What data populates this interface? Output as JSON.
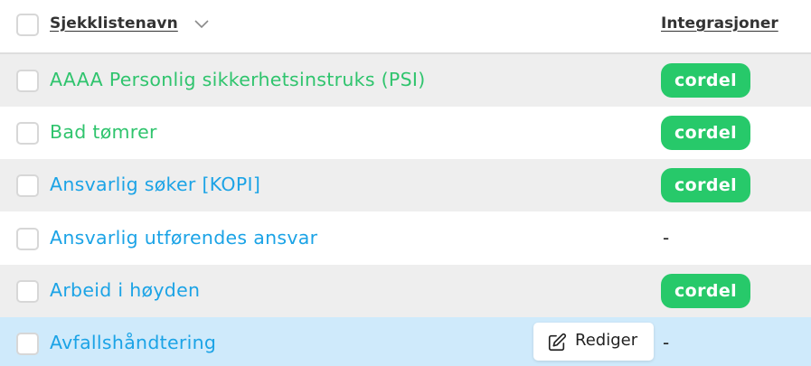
{
  "header": {
    "name_label": "Sjekklistenavn",
    "integrations_label": "Integrasjoner",
    "sort_icon": "chevron-down-icon"
  },
  "colors": {
    "green_link": "#2fc46d",
    "blue_link": "#1ba3e6",
    "badge_green": "#27c96a",
    "row_alt": "#eeeeee",
    "row_white": "#ffffff",
    "row_hover": "#cfeafb",
    "header_border": "#dedede"
  },
  "rows": [
    {
      "name": "AAAA Personlig sikkerhetsinstruks (PSI)",
      "link_color": "green",
      "integration": "cordel"
    },
    {
      "name": "Bad tømrer",
      "link_color": "green",
      "integration": "cordel"
    },
    {
      "name": "Ansvarlig søker [KOPI]",
      "link_color": "blue",
      "integration": "cordel"
    },
    {
      "name": "Ansvarlig utførendes ansvar",
      "link_color": "blue",
      "integration": "-"
    },
    {
      "name": "Arbeid i høyden",
      "link_color": "blue",
      "integration": "cordel"
    },
    {
      "name": "Avfallshåndtering",
      "link_color": "blue",
      "integration": "-",
      "hovered": true
    }
  ],
  "edit_button": {
    "label": "Rediger",
    "icon": "edit-icon"
  }
}
